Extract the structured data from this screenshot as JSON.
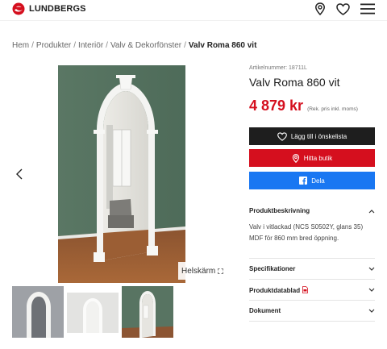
{
  "header": {
    "brand": "LUNDBERGS",
    "icons": [
      "location-pin-icon",
      "heart-icon",
      "hamburger-menu-icon"
    ]
  },
  "breadcrumb": {
    "items": [
      "Hem",
      "Produkter",
      "Interiör",
      "Valv & Dekorfönster"
    ],
    "separator": "/",
    "current": "Valv Roma 860 vit"
  },
  "gallery": {
    "fullscreen_label": "Helskärm",
    "thumbnail_count": 3
  },
  "product": {
    "article_number": "Artikelnummer: 18711L",
    "title": "Valv Roma 860 vit",
    "price": "4 879 kr",
    "price_note": "(Rek. pris inkl. moms)"
  },
  "actions": {
    "wishlist": "Lägg till i önskelista",
    "find_store": "Hitta butik",
    "share": "Dela"
  },
  "accordion": {
    "description_title": "Produktbeskrivning",
    "description_lines": [
      "Valv i vitlackad (NCS S0502Y, glans 35)",
      "MDF för 860 mm bred öppning."
    ],
    "specs_title": "Specifikationer",
    "datasheet_title": "Produktdatablad",
    "documents_title": "Dokument"
  },
  "colors": {
    "brand_red": "#d50f1e",
    "button_dark": "#1e1e1e",
    "facebook_blue": "#1977f2",
    "wall_green": "#5d7a67"
  }
}
